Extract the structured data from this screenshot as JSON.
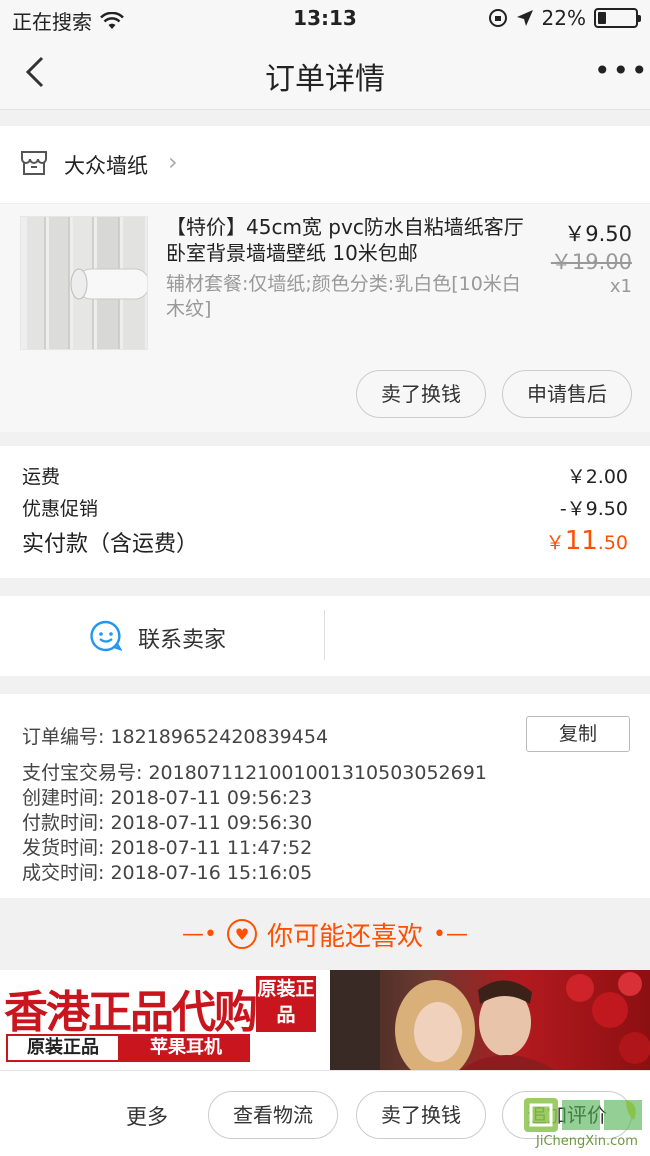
{
  "status_bar": {
    "carrier": "正在搜索",
    "time": "13:13",
    "battery": "22%",
    "battery_level": 0.22
  },
  "nav": {
    "title": "订单详情",
    "more": "•••"
  },
  "shop": {
    "name": "大众墙纸"
  },
  "product": {
    "title": "【特价】45cm宽 pvc防水自粘墙纸客厅卧室背景墙墙壁纸 10米包邮",
    "spec": "辅材套餐:仅墙纸;颜色分类:乳白色[10米白木纹]",
    "price": "￥9.50",
    "original_price": "￥19.00",
    "quantity": "x1",
    "sell_button": "卖了换钱",
    "aftersale_button": "申请售后"
  },
  "fees": {
    "shipping_label": "运费",
    "shipping_value": "￥2.00",
    "discount_label": "优惠促销",
    "discount_value": "-￥9.50",
    "total_label": "实付款（含运费）",
    "total_symbol": "￥",
    "total_int": "11",
    "total_dec": ".50"
  },
  "contact": {
    "label": "联系卖家"
  },
  "order": {
    "number": "订单编号:  182189652420839454",
    "copy": "复制",
    "alipay": "支付宝交易号:  2018071121001001310503052691",
    "created": "创建时间:  2018-07-11 09:56:23",
    "paid": "付款时间:  2018-07-11 09:56:30",
    "shipped": "发货时间:  2018-07-11 11:47:52",
    "completed": "成交时间:  2018-07-16 15:16:05"
  },
  "recommend": {
    "title": "你可能还喜欢"
  },
  "banner": {
    "headline": "香港正品代购",
    "stamp": "原装正品",
    "tag_left": "原装正品",
    "tag_right": "苹果耳机"
  },
  "bottom": {
    "more": "更多",
    "logistics": "查看物流",
    "sell": "卖了换钱",
    "review": "追加评价"
  },
  "watermark": {
    "text": "JiChengXin.com"
  },
  "colors": {
    "accent": "#ff5000",
    "icon_blue": "#2196f3"
  }
}
